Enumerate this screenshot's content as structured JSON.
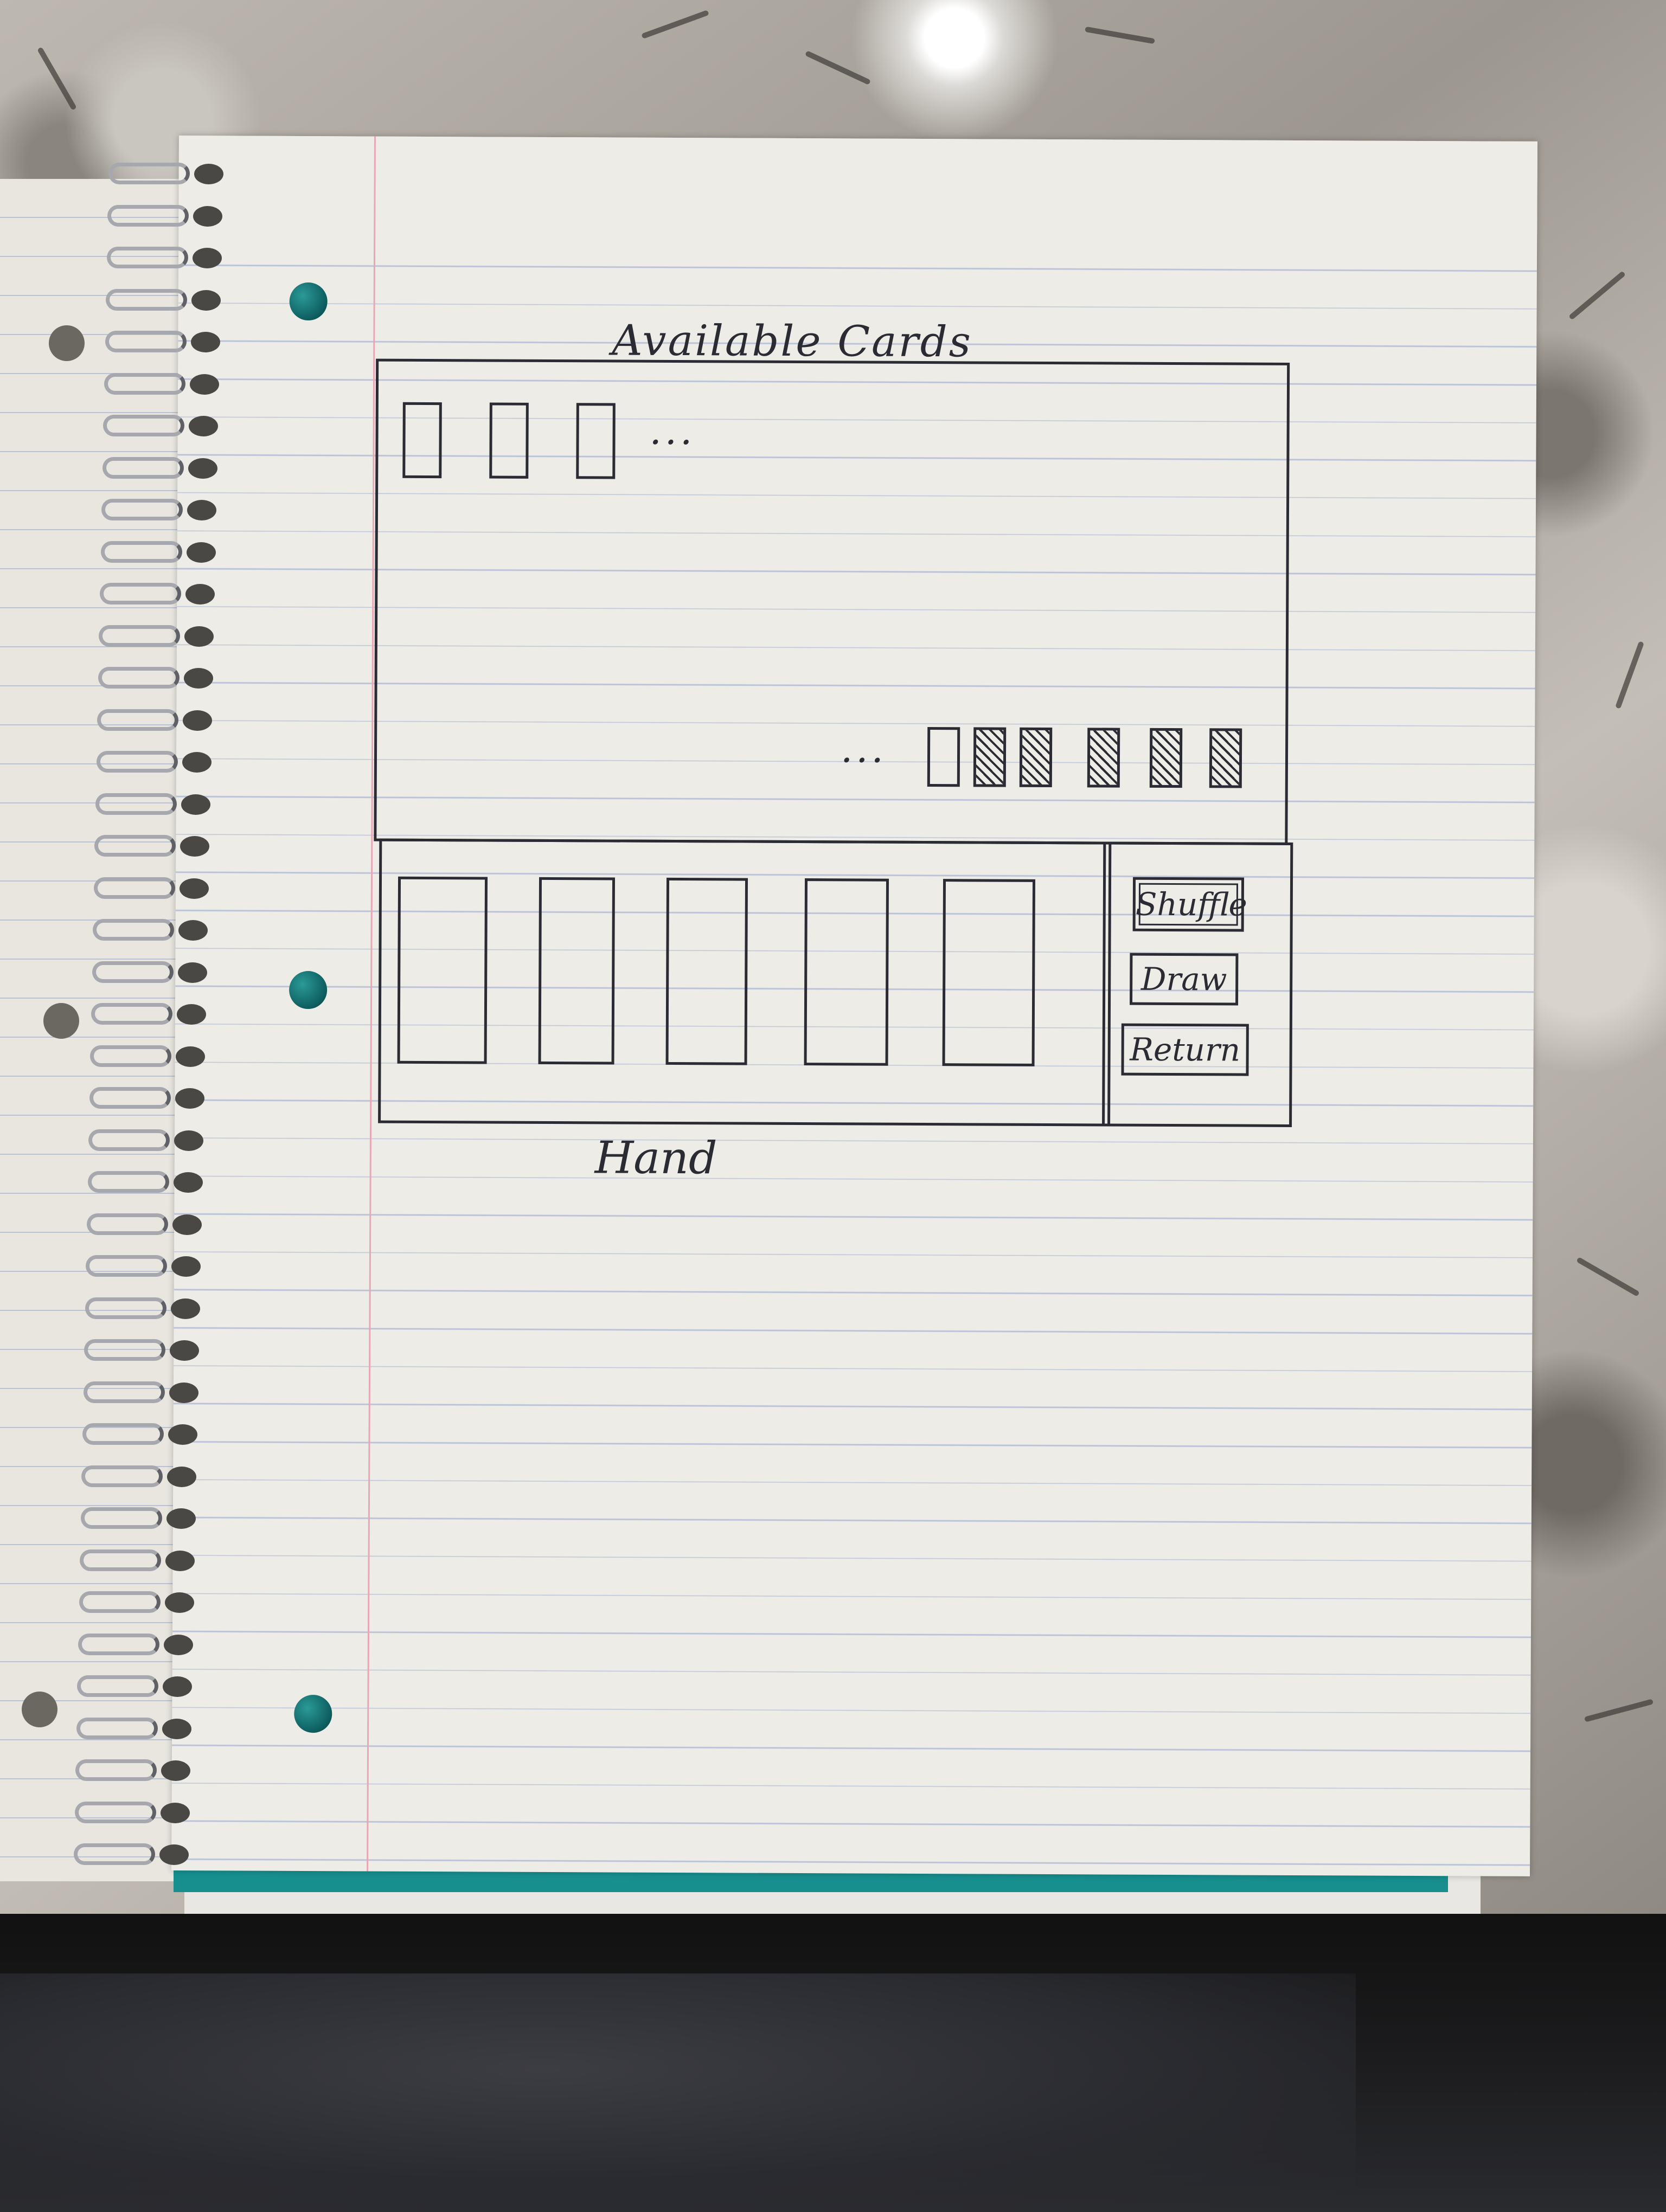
{
  "sketch": {
    "available_panel": {
      "title": "Available Cards",
      "top_row_ellipsis": "...",
      "bottom_row_ellipsis": "..."
    },
    "hand_panel": {
      "title": "Hand"
    },
    "controls": {
      "shuffle_label": "Shuffle",
      "draw_label": "Draw",
      "return_label": "Return"
    }
  },
  "colors": {
    "ink": "#2b2b33",
    "paper": "#eeece7",
    "rule_line": "#b8c1d7",
    "margin_line": "#e7a7b4",
    "notebook_cover": "#178f8f"
  }
}
